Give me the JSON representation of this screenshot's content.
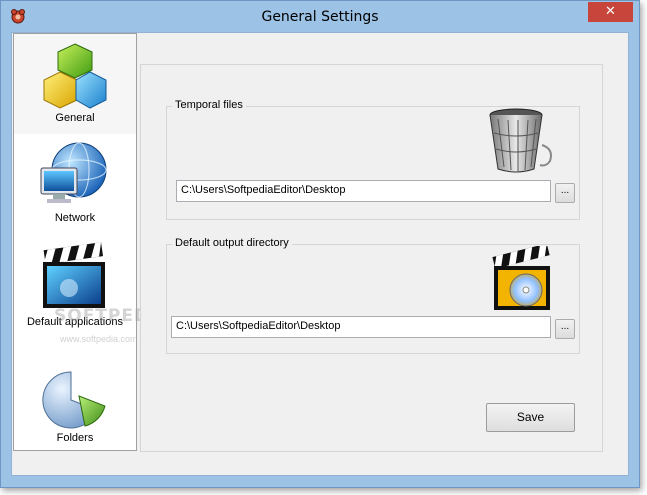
{
  "window": {
    "title": "General Settings",
    "close_symbol": "✕",
    "app_icon": "app-logo-icon"
  },
  "sidebar": {
    "items": [
      {
        "label": "General",
        "icon": "cubes-icon",
        "selected": true
      },
      {
        "label": "Network",
        "icon": "globe-monitor-icon",
        "selected": false
      },
      {
        "label": "Default applications",
        "icon": "clapperboard-icon",
        "selected": false
      },
      {
        "label": "Folders",
        "icon": "pie-chart-icon",
        "selected": false
      }
    ],
    "watermark": "SOFTPEDIA",
    "watermark_sub": "www.softpedia.com"
  },
  "temporal_files": {
    "legend": "Temporal files",
    "path": "C:\\Users\\SoftpediaEditor\\Desktop",
    "browse_label": "...",
    "icon": "recycle-bin-icon"
  },
  "output_directory": {
    "legend": "Default output directory",
    "path": "C:\\Users\\SoftpediaEditor\\Desktop",
    "browse_label": "...",
    "icon": "clapperboard-disc-icon"
  },
  "save_label": "Save"
}
